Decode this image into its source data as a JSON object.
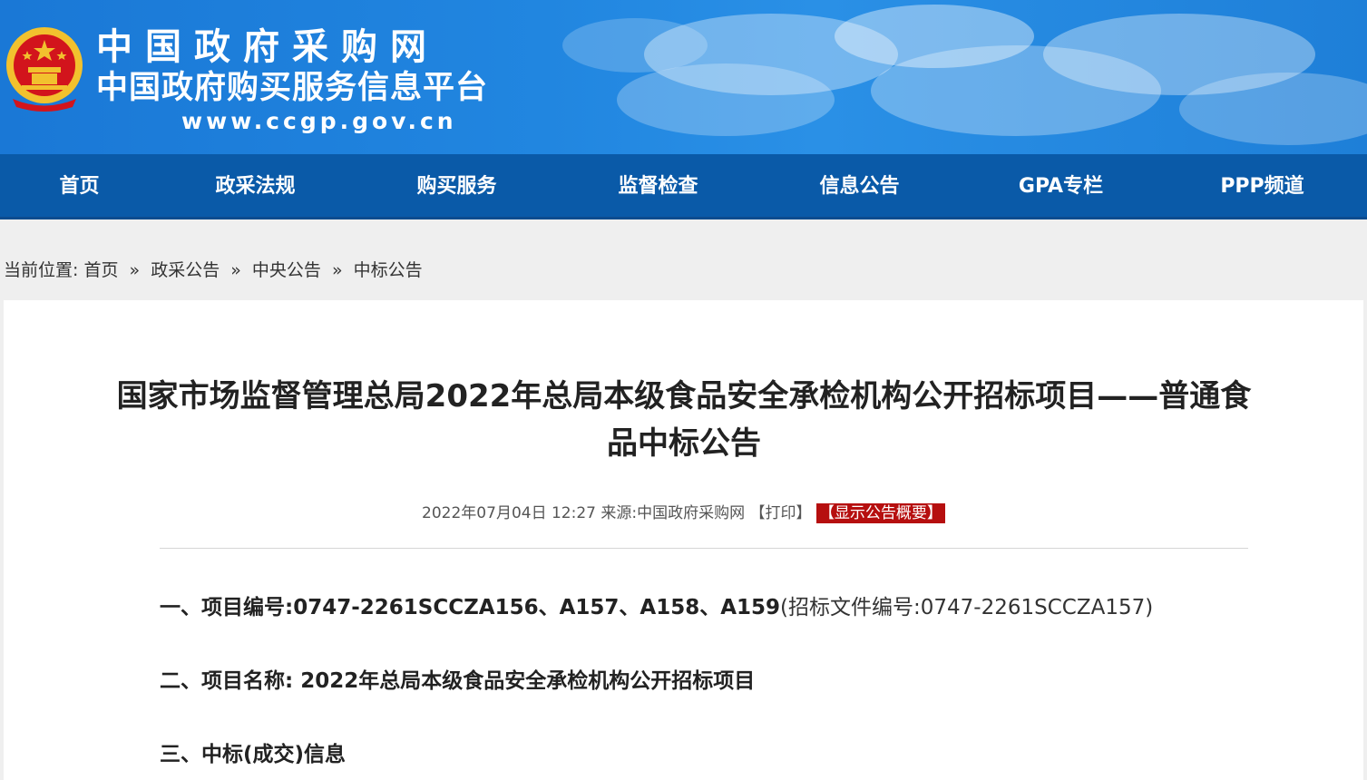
{
  "header": {
    "title": "中国政府采购网",
    "subtitle": "中国政府购买服务信息平台",
    "url": "www.ccgp.gov.cn",
    "emblem_icon": "national-emblem-icon",
    "colors": {
      "banner": "#1e7fd8",
      "nav": "#0a5aa8",
      "accent_red": "#b60f0f"
    }
  },
  "nav": {
    "items": [
      {
        "label": "首页"
      },
      {
        "label": "政采法规"
      },
      {
        "label": "购买服务"
      },
      {
        "label": "监督检查"
      },
      {
        "label": "信息公告"
      },
      {
        "label": "GPA专栏"
      },
      {
        "label": "PPP频道"
      }
    ]
  },
  "breadcrumb": {
    "prefix": "当前位置:",
    "items": [
      "首页",
      "政采公告",
      "中央公告",
      "中标公告"
    ],
    "separator": "»"
  },
  "article": {
    "title_line1": "国家市场监督管理总局2022年总局本级食品安全承检机构公开招标项目——普通食",
    "title_line2": "品中标公告",
    "date": "2022年07月04日 12:27",
    "source_label": "来源:",
    "source": "中国政府采购网",
    "print": "【打印】",
    "summary": "【显示公告概要】",
    "sections": [
      {
        "label": "一、项目编号:",
        "value": "0747-2261SCCZA156、A157、A158、A159",
        "note": "(招标文件编号:0747-2261SCCZA157)"
      },
      {
        "label": "二、项目名称: ",
        "value": "2022年总局本级食品安全承检机构公开招标项目"
      },
      {
        "label": "三、中标(成交)信息"
      }
    ]
  }
}
